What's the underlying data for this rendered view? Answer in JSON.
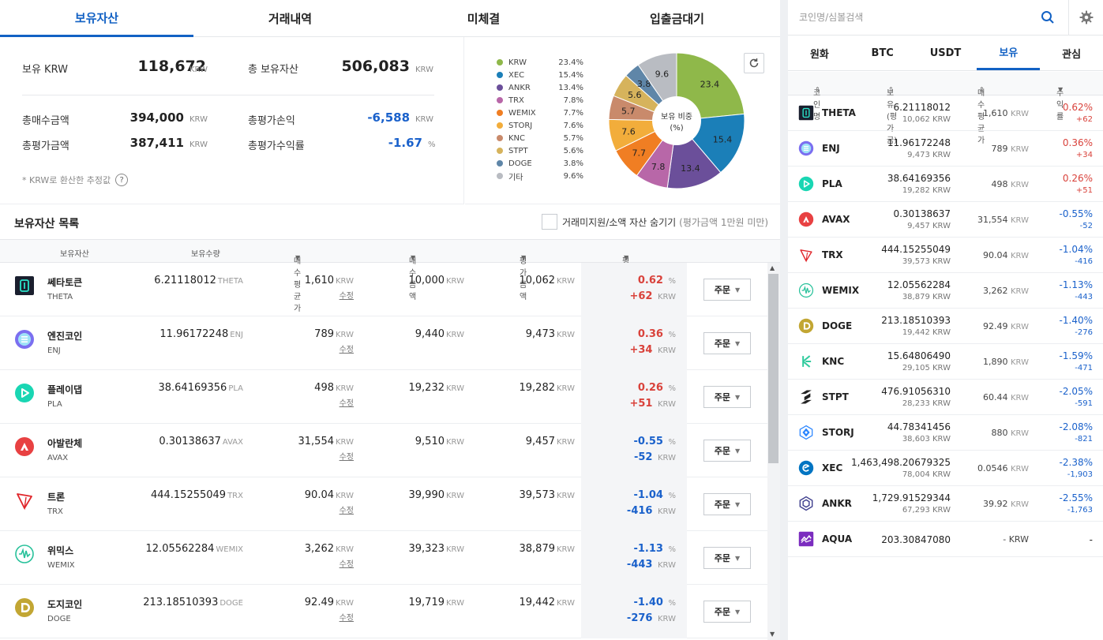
{
  "tabs": [
    "보유자산",
    "거래내역",
    "미체결",
    "입출금대기"
  ],
  "summary": {
    "krw_label": "보유 KRW",
    "krw_value": "118,672",
    "total_label": "총 보유자산",
    "total_value": "506,083",
    "unit": "KRW",
    "buy_label": "총매수금액",
    "buy_value": "394,000",
    "eval_label": "총평가금액",
    "eval_value": "387,411",
    "pl_label": "총평가손익",
    "pl_value": "-6,588",
    "rate_label": "총평가수익률",
    "rate_value": "-1.67",
    "rate_unit": "%",
    "note": "* KRW로 환산한 추정값",
    "help_icon": "?"
  },
  "pie": {
    "center_label_1": "보유 비중",
    "center_label_2": "(%)",
    "legend": [
      {
        "name": "KRW",
        "value": "23.4%"
      },
      {
        "name": "XEC",
        "value": "15.4%"
      },
      {
        "name": "ANKR",
        "value": "13.4%"
      },
      {
        "name": "TRX",
        "value": "7.8%"
      },
      {
        "name": "WEMIX",
        "value": "7.7%"
      },
      {
        "name": "STORJ",
        "value": "7.6%"
      },
      {
        "name": "KNC",
        "value": "5.7%"
      },
      {
        "name": "STPT",
        "value": "5.6%"
      },
      {
        "name": "DOGE",
        "value": "3.8%"
      },
      {
        "name": "기타",
        "value": "9.6%"
      }
    ],
    "colors": [
      "#8fb84a",
      "#1b7fb8",
      "#6b4f9a",
      "#b867a8",
      "#f07e23",
      "#f2ad3b",
      "#c98a6b",
      "#d6b35c",
      "#5f86a8",
      "#b9bcc2"
    ]
  },
  "chart_data": {
    "type": "pie",
    "title": "보유 비중 (%)",
    "categories": [
      "KRW",
      "XEC",
      "ANKR",
      "TRX",
      "WEMIX",
      "STORJ",
      "KNC",
      "STPT",
      "DOGE",
      "기타"
    ],
    "values": [
      23.4,
      15.4,
      13.4,
      7.8,
      7.7,
      7.6,
      5.7,
      5.6,
      3.8,
      9.6
    ]
  },
  "list": {
    "title": "보유자산 목록",
    "hide_label": "거래미지원/소액 자산 숨기기",
    "hide_sub": "(평가금액 1만원 미만)",
    "columns": [
      "보유자산",
      "보유수량",
      "매수평균가",
      "매수금액",
      "평가금액",
      "평가손익(%)"
    ],
    "unit": "KRW",
    "pct": "%",
    "edit_label": "수정",
    "order_label": "주문",
    "rows": [
      {
        "name": "쎄타토큰",
        "sym": "THETA",
        "qty": "6.21118012",
        "avg": "1,610",
        "buy": "10,000",
        "eval": "10,062",
        "rate": "0.62",
        "pl": "+62",
        "dir": "up"
      },
      {
        "name": "엔진코인",
        "sym": "ENJ",
        "qty": "11.96172248",
        "avg": "789",
        "buy": "9,440",
        "eval": "9,473",
        "rate": "0.36",
        "pl": "+34",
        "dir": "up"
      },
      {
        "name": "플레이댑",
        "sym": "PLA",
        "qty": "38.64169356",
        "avg": "498",
        "buy": "19,232",
        "eval": "19,282",
        "rate": "0.26",
        "pl": "+51",
        "dir": "up"
      },
      {
        "name": "아발란체",
        "sym": "AVAX",
        "qty": "0.30138637",
        "avg": "31,554",
        "buy": "9,510",
        "eval": "9,457",
        "rate": "-0.55",
        "pl": "-52",
        "dir": "down"
      },
      {
        "name": "트론",
        "sym": "TRX",
        "qty": "444.15255049",
        "avg": "90.04",
        "buy": "39,990",
        "eval": "39,573",
        "rate": "-1.04",
        "pl": "-416",
        "dir": "down"
      },
      {
        "name": "위믹스",
        "sym": "WEMIX",
        "qty": "12.05562284",
        "avg": "3,262",
        "buy": "39,323",
        "eval": "38,879",
        "rate": "-1.13",
        "pl": "-443",
        "dir": "down"
      },
      {
        "name": "도지코인",
        "sym": "DOGE",
        "qty": "213.18510393",
        "avg": "92.49",
        "buy": "19,719",
        "eval": "19,442",
        "rate": "-1.40",
        "pl": "-276",
        "dir": "down"
      }
    ]
  },
  "right": {
    "search_placeholder": "코인명/심볼검색",
    "market_tabs": [
      "원화",
      "BTC",
      "USDT",
      "보유",
      "관심"
    ],
    "columns": [
      "코인명",
      "보유(평가금)",
      "매수평균가",
      "수익률"
    ],
    "unit": "KRW",
    "rows": [
      {
        "sym": "THETA",
        "qty": "6.21118012",
        "eval": "10,062",
        "avg": "1,610",
        "pct": "0.62%",
        "pl": "+62",
        "dir": "up"
      },
      {
        "sym": "ENJ",
        "qty": "11.96172248",
        "eval": "9,473",
        "avg": "789",
        "pct": "0.36%",
        "pl": "+34",
        "dir": "up"
      },
      {
        "sym": "PLA",
        "qty": "38.64169356",
        "eval": "19,282",
        "avg": "498",
        "pct": "0.26%",
        "pl": "+51",
        "dir": "up"
      },
      {
        "sym": "AVAX",
        "qty": "0.30138637",
        "eval": "9,457",
        "avg": "31,554",
        "pct": "-0.55%",
        "pl": "-52",
        "dir": "down"
      },
      {
        "sym": "TRX",
        "qty": "444.15255049",
        "eval": "39,573",
        "avg": "90.04",
        "pct": "-1.04%",
        "pl": "-416",
        "dir": "down"
      },
      {
        "sym": "WEMIX",
        "qty": "12.05562284",
        "eval": "38,879",
        "avg": "3,262",
        "pct": "-1.13%",
        "pl": "-443",
        "dir": "down"
      },
      {
        "sym": "DOGE",
        "qty": "213.18510393",
        "eval": "19,442",
        "avg": "92.49",
        "pct": "-1.40%",
        "pl": "-276",
        "dir": "down"
      },
      {
        "sym": "KNC",
        "qty": "15.64806490",
        "eval": "29,105",
        "avg": "1,890",
        "pct": "-1.59%",
        "pl": "-471",
        "dir": "down"
      },
      {
        "sym": "STPT",
        "qty": "476.91056310",
        "eval": "28,233",
        "avg": "60.44",
        "pct": "-2.05%",
        "pl": "-591",
        "dir": "down"
      },
      {
        "sym": "STORJ",
        "qty": "44.78341456",
        "eval": "38,603",
        "avg": "880",
        "pct": "-2.08%",
        "pl": "-821",
        "dir": "down"
      },
      {
        "sym": "XEC",
        "qty": "1,463,498.20679325",
        "eval": "78,004",
        "avg": "0.0546",
        "pct": "-2.38%",
        "pl": "-1,903",
        "dir": "down"
      },
      {
        "sym": "ANKR",
        "qty": "1,729.91529344",
        "eval": "67,293",
        "avg": "39.92",
        "pct": "-2.55%",
        "pl": "-1,763",
        "dir": "down"
      },
      {
        "sym": "AQUA",
        "qty": "203.30847080",
        "eval": "",
        "avg": "-",
        "pct": "-",
        "pl": "",
        "dir": "none"
      }
    ]
  }
}
